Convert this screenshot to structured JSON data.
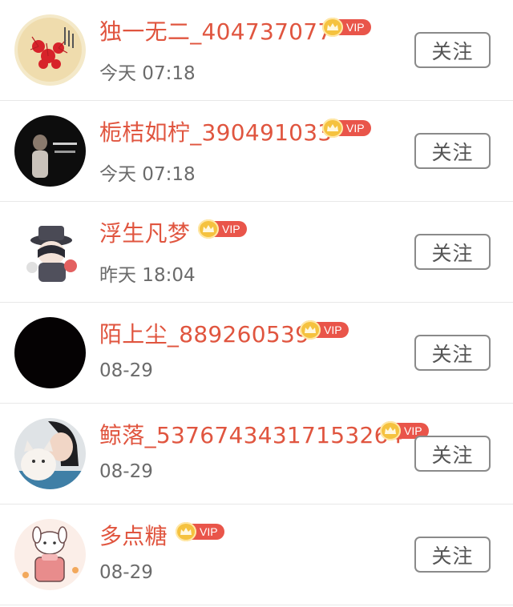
{
  "follow_label": "关注",
  "vip_label": "VIP",
  "accent": "#e0553f",
  "items": [
    {
      "name": "独一无二_404737077",
      "time": "今天 07:18",
      "avatar": "red-spider-lily-avatar"
    },
    {
      "name": "栀桔如柠_390491033",
      "time": "今天 07:18",
      "avatar": "dark-person-avatar"
    },
    {
      "name": "浮生凡梦",
      "time": "昨天 18:04",
      "avatar": "anime-hat-avatar"
    },
    {
      "name": "陌上尘_889260539",
      "time": "08-29",
      "avatar": "black-avatar"
    },
    {
      "name": "鲸落_53767434317153264",
      "time": "08-29",
      "avatar": "girl-with-cat-avatar"
    },
    {
      "name": "多点糖",
      "time": "08-29",
      "avatar": "bunny-cartoon-avatar"
    }
  ]
}
